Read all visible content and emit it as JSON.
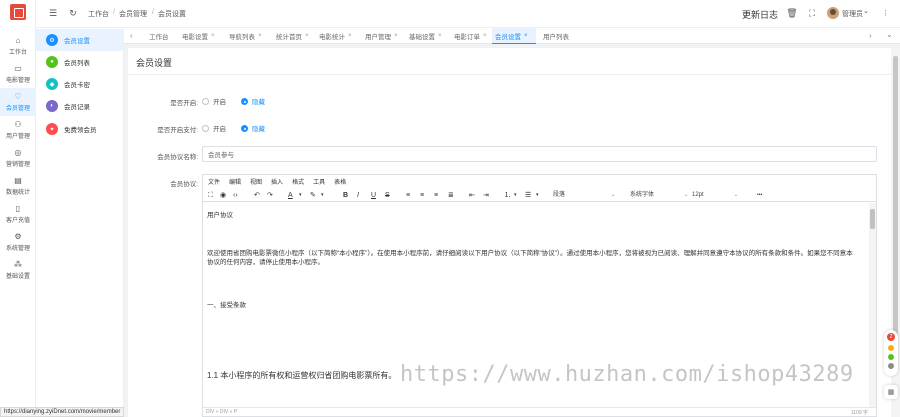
{
  "rail": {
    "items": [
      {
        "label": "工作台",
        "icon": "home-icon",
        "glyph": "⌂"
      },
      {
        "label": "电影管理",
        "icon": "video-icon",
        "glyph": "▭"
      },
      {
        "label": "会员管理",
        "icon": "member-icon",
        "glyph": "♡"
      },
      {
        "label": "用户管理",
        "icon": "user-icon",
        "glyph": "⚇"
      },
      {
        "label": "营销管理",
        "icon": "marketing-icon",
        "glyph": "◎"
      },
      {
        "label": "数据统计",
        "icon": "stats-icon",
        "glyph": "▤"
      },
      {
        "label": "客户充值",
        "icon": "phone-icon",
        "glyph": "▯"
      },
      {
        "label": "系统管理",
        "icon": "settings-icon",
        "glyph": "⚙"
      },
      {
        "label": "基础设置",
        "icon": "grid-icon",
        "glyph": "⁂"
      }
    ],
    "active_index": 2
  },
  "submenu": {
    "items": [
      {
        "label": "会员设置",
        "color": "#1890ff",
        "glyph": "⚙"
      },
      {
        "label": "会员列表",
        "color": "#52c41a",
        "glyph": "●"
      },
      {
        "label": "会员卡密",
        "color": "#13c2c2",
        "glyph": "◆"
      },
      {
        "label": "会员记录",
        "color": "#7b68c8",
        "glyph": "◐"
      },
      {
        "label": "免费领会员",
        "color": "#ff4d4f",
        "glyph": "✦"
      }
    ],
    "active_index": 0
  },
  "topbar": {
    "breadcrumb": [
      "工作台",
      "会员管理",
      "会员设置"
    ],
    "update_log": "更新日志",
    "user_name": "管理员",
    "caret": "⌄",
    "more": "⋮"
  },
  "tabs": {
    "items": [
      {
        "label": "工作台",
        "closable": false
      },
      {
        "label": "电影设置",
        "closable": true
      },
      {
        "label": "导航列表",
        "closable": true
      },
      {
        "label": "统计首页",
        "closable": true
      },
      {
        "label": "电影统计",
        "closable": true
      },
      {
        "label": "用户管理",
        "closable": true
      },
      {
        "label": "基础设置",
        "closable": true
      },
      {
        "label": "电影订单",
        "closable": true
      },
      {
        "label": "会员设置",
        "closable": true
      },
      {
        "label": "用户列表",
        "closable": false
      }
    ],
    "active_index": 8,
    "close_glyph": "×",
    "prev": "‹",
    "next": "›",
    "dropdown": "⌄"
  },
  "panel": {
    "title": "会员设置",
    "fields": {
      "member_enable": {
        "label": "是否开启:",
        "options": [
          "开启",
          "隐藏"
        ],
        "selected": 1
      },
      "member_pay": {
        "label": "是否开启支付:",
        "options": [
          "开启",
          "隐藏"
        ],
        "selected": 1
      },
      "agreement_name": {
        "label": "会员协议名称:",
        "value": "会员参与"
      },
      "agreement": {
        "label": "会员协议:"
      }
    }
  },
  "editor": {
    "menu": [
      "文件",
      "编辑",
      "视图",
      "插入",
      "格式",
      "工具",
      "表格"
    ],
    "paragraph_select": "段落",
    "font_select": "系统字体",
    "size_select": "12pt",
    "more": "•••",
    "content": {
      "heading": "用户协议",
      "intro": "欢迎使用省团购电影票微信小程序（以下简称“本小程序”）。在使用本小程序前，请仔细阅读以下用户协议（以下简称“协议”）。通过使用本小程序，您将被视为已阅读、理解并同意遵守本协议的所有条款和条件。如果您不同意本协议的任何内容，请停止使用本小程序。",
      "section1": "一、接受条款",
      "clause_1_1": "1.1 本小程序的所有权和运营权归省团购电影票所有。"
    },
    "status_left": "DIV » DIV » P",
    "status_right": "1109 字"
  },
  "watermark": "https://www.huzhan.com/ishop43289",
  "url_tip": "https://dianying.zyiDnet.com/movie/member",
  "side_widget": {
    "badge": "2"
  },
  "colors": {
    "accent": "#1890ff",
    "active_bg": "#e8f3ff",
    "logo": "#e54a3b"
  }
}
